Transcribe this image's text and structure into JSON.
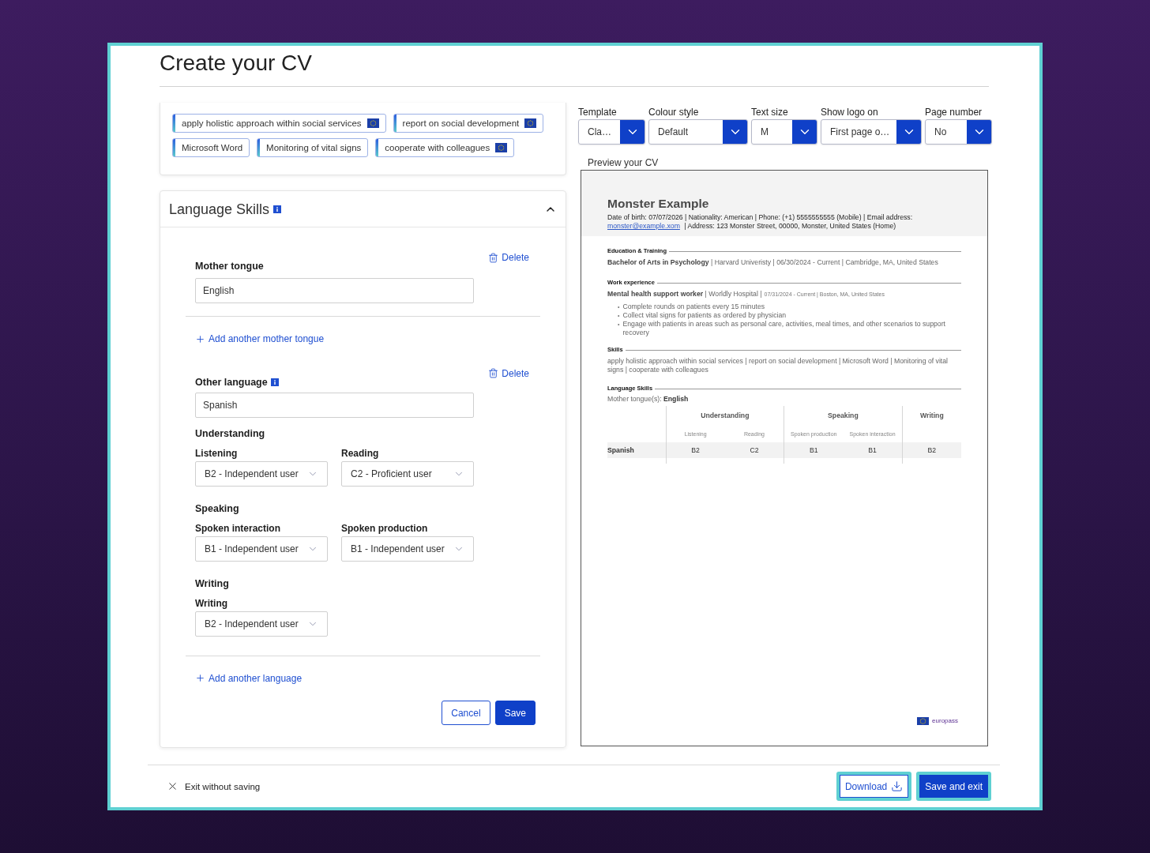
{
  "page": {
    "title": "Create your CV"
  },
  "skills": {
    "tags": [
      {
        "label": "apply holistic approach within social services",
        "eu_flag": true
      },
      {
        "label": "report on social development",
        "eu_flag": true
      },
      {
        "label": "Microsoft Word",
        "eu_flag": false
      },
      {
        "label": "Monitoring of vital signs",
        "eu_flag": false
      },
      {
        "label": "cooperate with colleagues",
        "eu_flag": true
      }
    ]
  },
  "language_skills": {
    "title": "Language Skills",
    "expanded": true,
    "mother_tongue": {
      "label": "Mother tongue",
      "value": "English",
      "delete": "Delete"
    },
    "add_mother_tongue": "Add another mother tongue",
    "other_language": {
      "label": "Other language",
      "value": "Spanish",
      "delete": "Delete",
      "groups": [
        {
          "title": "Understanding",
          "fields": [
            {
              "label": "Listening",
              "value": "B2 - Independent user"
            },
            {
              "label": "Reading",
              "value": "C2 - Proficient user"
            }
          ]
        },
        {
          "title": "Speaking",
          "fields": [
            {
              "label": "Spoken interaction",
              "value": "B1 - Independent user"
            },
            {
              "label": "Spoken production",
              "value": "B1 - Independent user"
            }
          ]
        },
        {
          "title": "Writing",
          "fields": [
            {
              "label": "Writing",
              "value": "B2 - Independent user"
            }
          ]
        }
      ]
    },
    "add_language": "Add another language",
    "buttons": [
      {
        "label": "Cancel",
        "kind": "secondary"
      },
      {
        "label": "Save",
        "kind": "primary"
      }
    ]
  },
  "settings": [
    {
      "label": "Template",
      "value": "Cla…"
    },
    {
      "label": "Colour style",
      "value": "Default"
    },
    {
      "label": "Text size",
      "value": "M"
    },
    {
      "label": "Show logo on",
      "value": "First page o…"
    },
    {
      "label": "Page number",
      "value": "No"
    }
  ],
  "preview": {
    "label": "Preview your CV",
    "name": "Monster Example",
    "contact": "Date of birth: 07/07/2026 | Nationality: American | Phone: (+1) 5555555555 (Mobile) | Email address:",
    "email": "monster@example.xom",
    "address": "| Address: 123 Monster Street, 00000, Monster, United States (Home)",
    "sections": [
      {
        "kind": "entry",
        "title": "Education & Training",
        "heading": "**Bachelor of Arts in Psychology** | Harvard Univeristy | 06/30/2024 - Current | Cambridge, MA, United States"
      },
      {
        "kind": "entry",
        "title": "Work experience",
        "heading": "**Mental health support worker** | Worldly Hospital |",
        "meta": "07/31/2024 - Current | Boston, MA, United States",
        "marker": "•",
        "bullets": [
          "Complete rounds on patients every 15 minutes",
          "Collect vital signs for patients as ordered by physician",
          "Engage with patients in areas such as personal care, activities, meal times, and other scenarios to support recovery"
        ]
      },
      {
        "kind": "text",
        "title": "Skills",
        "text": "apply holistic approach within social services | report on social development | Microsoft Word | Monitoring of vital signs | cooperate with colleagues"
      },
      {
        "kind": "languages",
        "title": "Language Skills",
        "mother_tongue": "Mother tongue(s): **English**",
        "table": {
          "groups": [
            {
              "label": "Understanding",
              "columns": [
                "Listening",
                "Reading"
              ]
            },
            {
              "label": "Speaking",
              "columns": [
                "Spoken production",
                "Spoken interaction"
              ]
            },
            {
              "label": "Writing"
            }
          ],
          "rows": [
            {
              "language": "Spanish",
              "levels": [
                "B2",
                "C2",
                "B1",
                "B1",
                "B2"
              ]
            }
          ]
        }
      }
    ],
    "logo": "europass"
  },
  "footer": {
    "exit": "Exit without saving",
    "buttons": [
      {
        "label": "Download",
        "kind": "secondary",
        "highlighted": true
      },
      {
        "label": "Save and exit",
        "kind": "primary",
        "highlighted": true
      }
    ]
  }
}
